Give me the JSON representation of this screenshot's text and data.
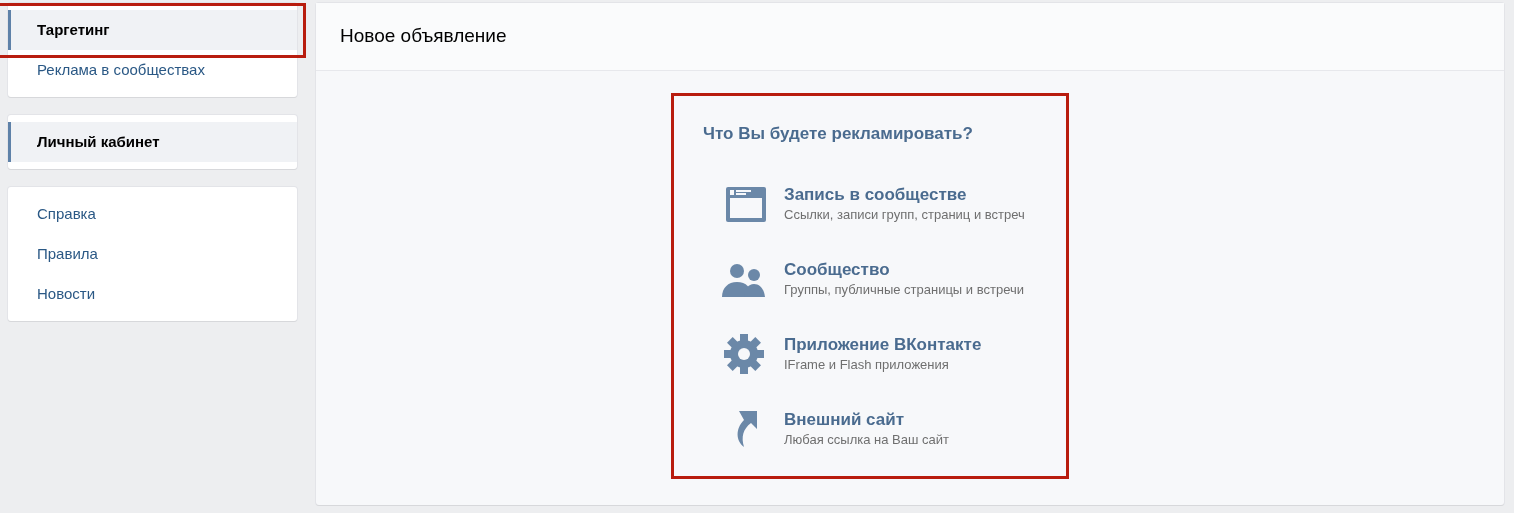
{
  "sidebar": {
    "groups": [
      {
        "items": [
          {
            "label": "Таргетинг",
            "selected": true,
            "highlighted": true
          },
          {
            "label": "Реклама в сообществах",
            "selected": false,
            "highlighted": false
          }
        ]
      },
      {
        "items": [
          {
            "label": "Личный кабинет",
            "selected": true,
            "highlighted": false
          }
        ]
      },
      {
        "items": [
          {
            "label": "Справка",
            "selected": false,
            "highlighted": false
          },
          {
            "label": "Правила",
            "selected": false,
            "highlighted": false
          },
          {
            "label": "Новости",
            "selected": false,
            "highlighted": false
          }
        ]
      }
    ]
  },
  "main": {
    "title": "Новое объявление",
    "chooser": {
      "highlighted": true,
      "question": "Что Вы будете рекламировать?",
      "options": [
        {
          "kind": "post",
          "title": "Запись в сообществе",
          "subtitle": "Ссылки, записи групп, страниц и встреч"
        },
        {
          "kind": "community",
          "title": "Сообщество",
          "subtitle": "Группы, публичные страницы и встречи"
        },
        {
          "kind": "app",
          "title": "Приложение ВКонтакте",
          "subtitle": "IFrame и Flash приложения"
        },
        {
          "kind": "site",
          "title": "Внешний сайт",
          "subtitle": "Любая ссылка на Ваш сайт"
        }
      ]
    }
  }
}
